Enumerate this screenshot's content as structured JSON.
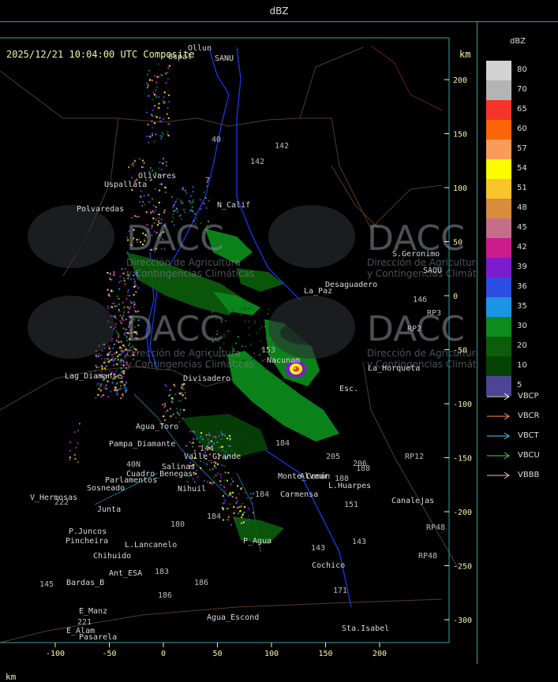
{
  "header": {
    "title": "dBZ"
  },
  "map": {
    "timestamp": "2025/12/21 10:04:00 UTC Composite",
    "unit_top": "km",
    "unit_bottom": "km",
    "x_ticks": [
      "-100",
      "-50",
      "0",
      "50",
      "100",
      "150",
      "200"
    ],
    "y_ticks": [
      "200",
      "150",
      "100",
      "50",
      "0",
      "-50",
      "-100",
      "-150",
      "-200",
      "-250",
      "-300"
    ],
    "watermark": {
      "brand": "DACC",
      "line1": "Dirección de Agricultura",
      "line2": "y Contingencias Climáticas"
    },
    "places": [
      {
        "name": "Olivares"
      },
      {
        "name": "Uspallata"
      },
      {
        "name": "Polvaredas"
      },
      {
        "name": "N_Calif"
      },
      {
        "name": "S.Geronimo"
      },
      {
        "name": "Desaguadero"
      },
      {
        "name": "La_Paz"
      },
      {
        "name": "Lag_Diamante"
      },
      {
        "name": "Divisadero"
      },
      {
        "name": "Nacunam"
      },
      {
        "name": "La_Horqueta"
      },
      {
        "name": "Esc."
      },
      {
        "name": "Agua_Toro"
      },
      {
        "name": "Pampa_Diamante"
      },
      {
        "name": "Valle_Grande"
      },
      {
        "name": "Salinas"
      },
      {
        "name": "Cuadro_Benegas"
      },
      {
        "name": "Parlamentos"
      },
      {
        "name": "Sosneado"
      },
      {
        "name": "V_Hermosas"
      },
      {
        "name": "Junta"
      },
      {
        "name": "P.Juncos"
      },
      {
        "name": "Pincheira"
      },
      {
        "name": "Chihuido"
      },
      {
        "name": "L.Lancanelo"
      },
      {
        "name": "Ant_ESA"
      },
      {
        "name": "Bardas_B"
      },
      {
        "name": "E_Manz"
      },
      {
        "name": "E_Alam"
      },
      {
        "name": "Pasarela"
      },
      {
        "name": "Agua_Escond"
      },
      {
        "name": "Cochico"
      },
      {
        "name": "Sta.Isabel"
      },
      {
        "name": "Carmensa"
      },
      {
        "name": "L.Huarpes"
      },
      {
        "name": "Canalejas"
      },
      {
        "name": "Alvear"
      },
      {
        "name": "Monte_Comán"
      },
      {
        "name": "P_Agua"
      },
      {
        "name": "Nihuil"
      },
      {
        "name": "Uspal"
      },
      {
        "name": "Ollun"
      },
      {
        "name": "SANU"
      },
      {
        "name": "SAOU"
      }
    ],
    "routes": [
      "40",
      "142",
      "142",
      "7",
      "146",
      "RP3",
      "RP2",
      "153",
      "205",
      "206",
      "188",
      "151",
      "143",
      "143",
      "171",
      "184",
      "184",
      "184",
      "180",
      "186",
      "186",
      "183",
      "145",
      "221",
      "RP12",
      "RP48",
      "RP48",
      "222",
      "144",
      "40N",
      "188"
    ]
  },
  "legend": {
    "title": "dBZ",
    "scale": [
      {
        "value": "80",
        "color": "#d3d3d3"
      },
      {
        "value": "70",
        "color": "#b4b4b4"
      },
      {
        "value": "65",
        "color": "#f8342a"
      },
      {
        "value": "60",
        "color": "#fc6408"
      },
      {
        "value": "57",
        "color": "#fc9a5c"
      },
      {
        "value": "54",
        "color": "#fcfc00"
      },
      {
        "value": "51",
        "color": "#fcc42c"
      },
      {
        "value": "48",
        "color": "#d88c3c"
      },
      {
        "value": "45",
        "color": "#c26e8a"
      },
      {
        "value": "42",
        "color": "#cc1c8c"
      },
      {
        "value": "39",
        "color": "#7c1ccc"
      },
      {
        "value": "36",
        "color": "#2c4ce4"
      },
      {
        "value": "35",
        "color": "#1c94e4"
      },
      {
        "value": "30",
        "color": "#0c8c1c"
      },
      {
        "value": "20",
        "color": "#0c5c0c"
      },
      {
        "value": "10",
        "color": "#064206"
      },
      {
        "value": "5",
        "color": "#4c4494"
      }
    ],
    "radars": [
      {
        "name": "VBCP",
        "color": "#ffffff"
      },
      {
        "name": "VBCR",
        "color": "#ff9c3c"
      },
      {
        "name": "VBCT",
        "color": "#3cd0ff"
      },
      {
        "name": "VBCU",
        "color": "#3cdc3c"
      },
      {
        "name": "VBBB",
        "color": "#ffb4c8"
      }
    ]
  }
}
